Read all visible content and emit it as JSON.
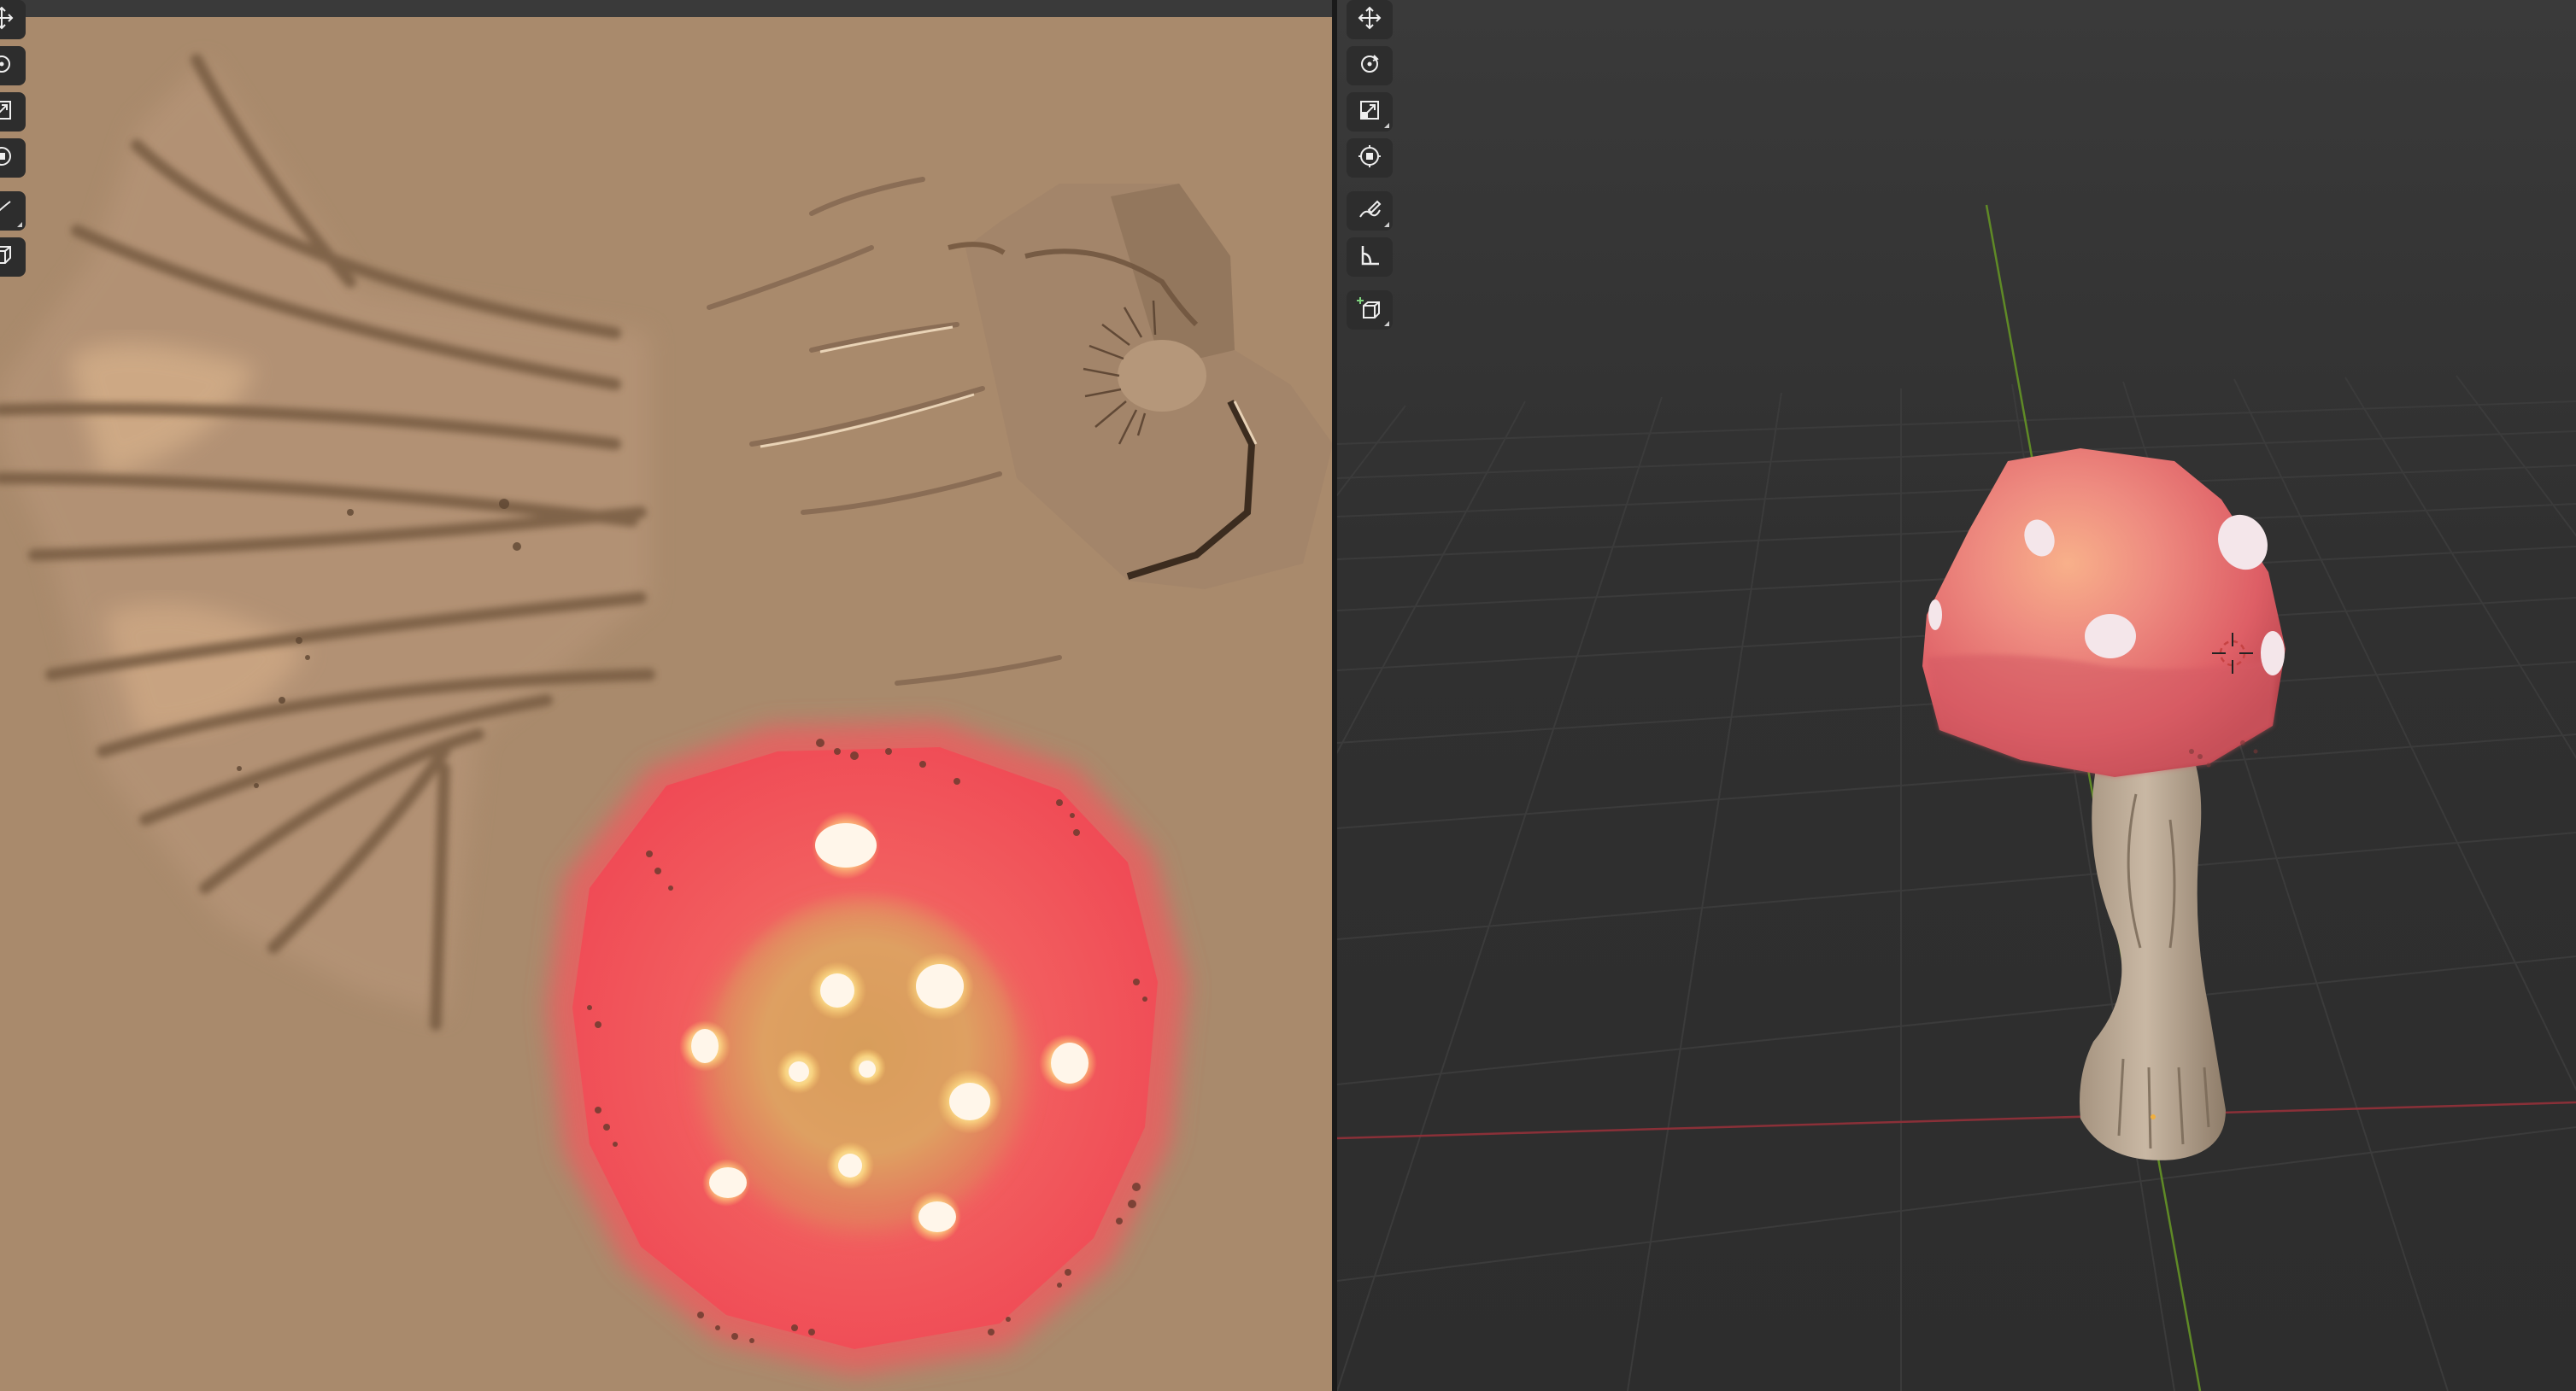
{
  "colors": {
    "uv_background": "#a98a6c",
    "viewport_background": "#2f2f2f",
    "cap_red": "#e35a5e",
    "stem": "#b9a795",
    "x_axis": "#b23a44",
    "y_axis": "#6a9a2a"
  },
  "image_editor": {
    "tools": [
      {
        "name": "move-icon"
      },
      {
        "name": "rotate-icon"
      },
      {
        "name": "scale-icon"
      },
      {
        "name": "transform-icon"
      },
      {
        "name": "annotate-icon"
      },
      {
        "name": "cube-add-icon"
      }
    ]
  },
  "viewport": {
    "tools": [
      {
        "name": "move-icon"
      },
      {
        "name": "rotate-icon"
      },
      {
        "name": "scale-icon"
      },
      {
        "name": "transform-icon"
      },
      {
        "name": "annotate-icon"
      },
      {
        "name": "measure-icon"
      },
      {
        "name": "add-cube-icon"
      }
    ]
  }
}
